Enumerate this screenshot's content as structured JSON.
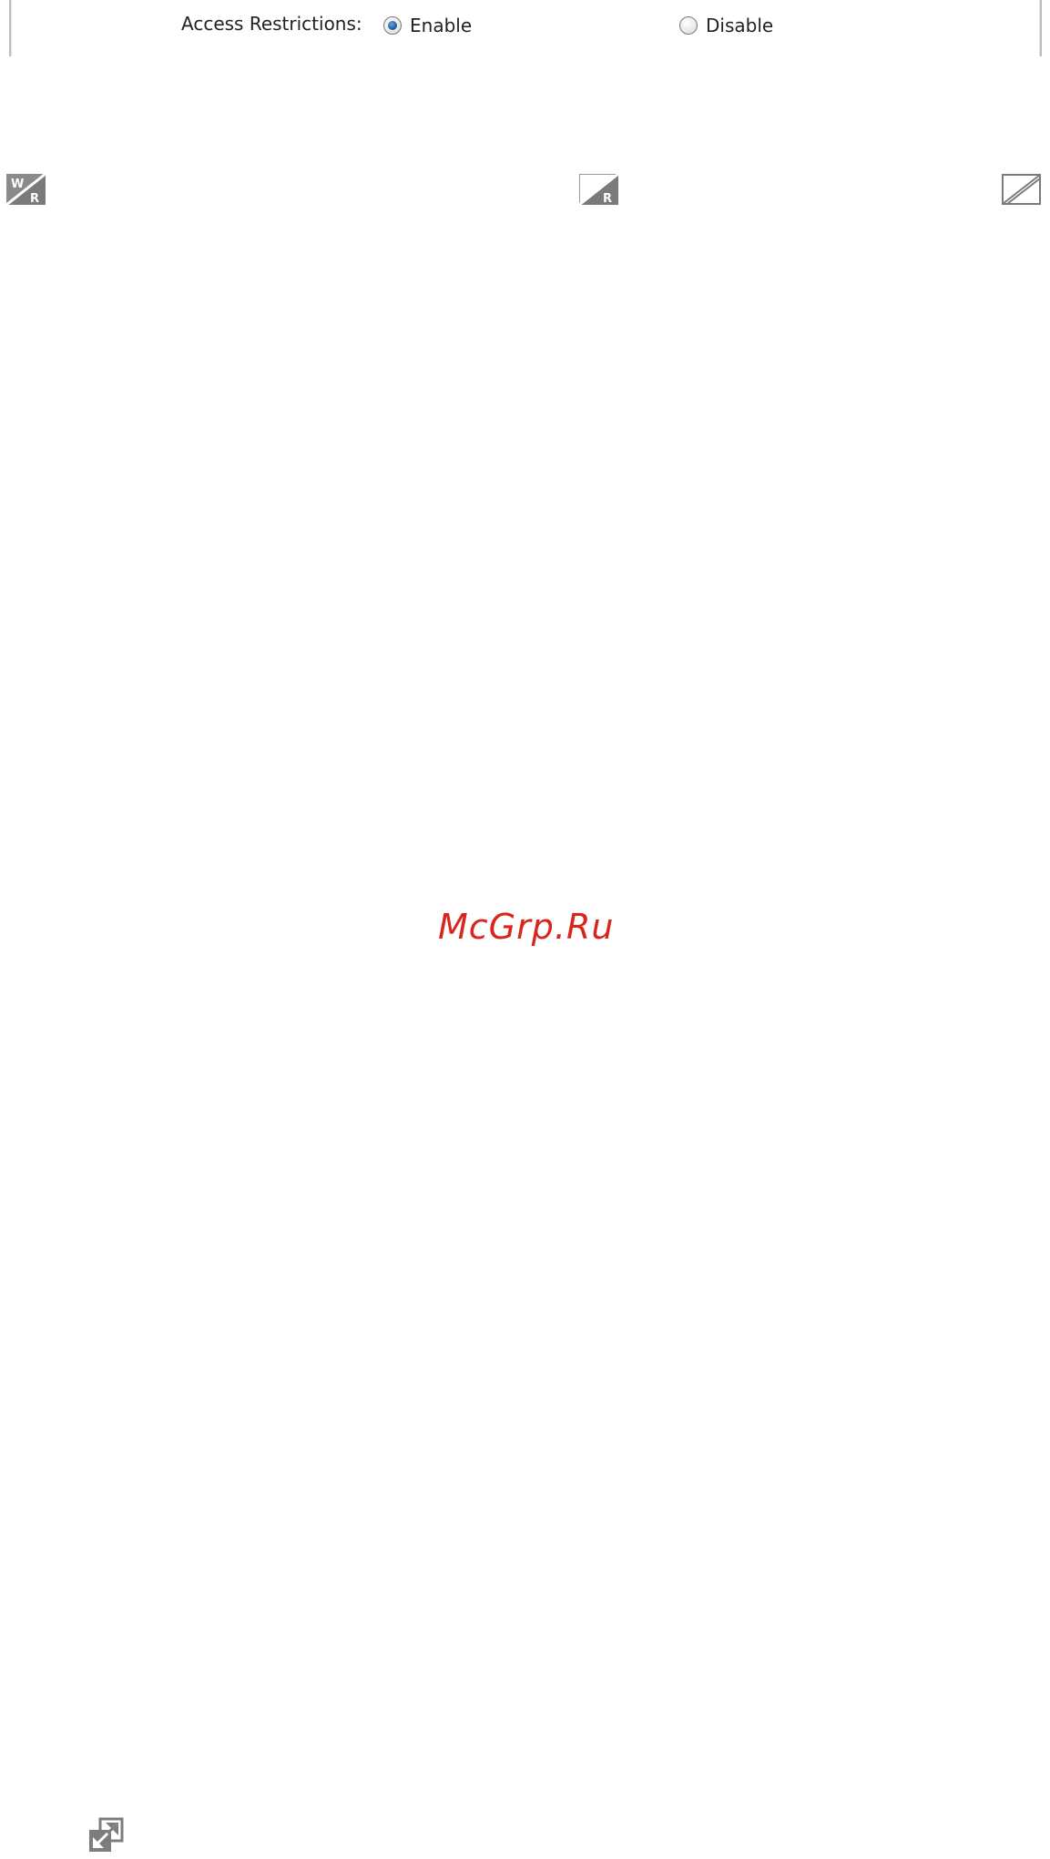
{
  "access": {
    "label": "Access Restrictions:",
    "options": [
      {
        "label": "Enable",
        "selected": true
      },
      {
        "label": "Disable",
        "selected": false
      }
    ]
  },
  "permission_icons": [
    {
      "name": "write-read-icon",
      "letters_top": "W",
      "letters_bottom": "R"
    },
    {
      "name": "read-only-icon",
      "letters_bottom": "R"
    },
    {
      "name": "no-access-icon"
    }
  ],
  "watermark": {
    "text": "McGrp.Ru"
  },
  "colors": {
    "accent": "#1f5ea8",
    "watermark": "#d9261c",
    "icon_gray": "#7d7d7d"
  }
}
